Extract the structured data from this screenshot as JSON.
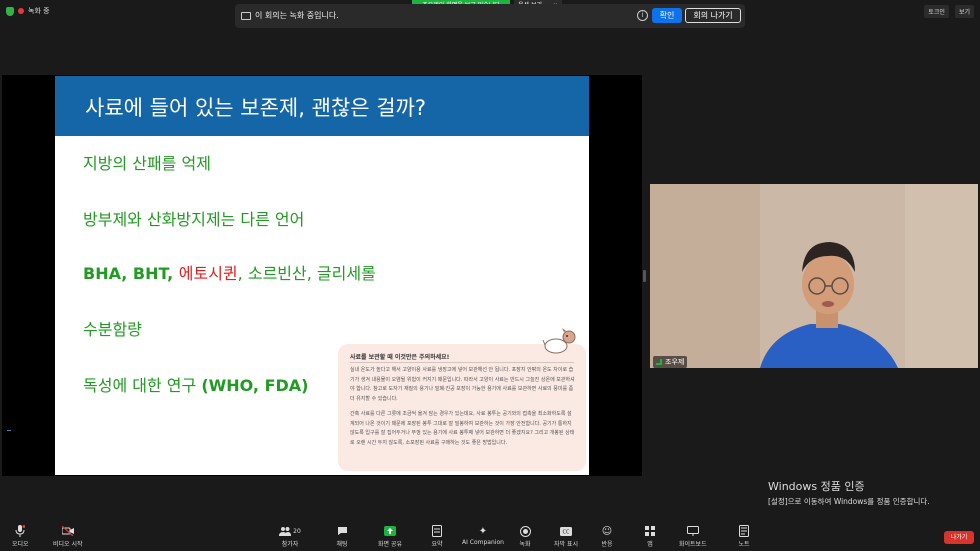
{
  "topbar": {
    "recording_label": "녹화 중",
    "share_status": "조우제의 화면을 보고 있습니다",
    "view_options": "옵션 보기",
    "recording_banner": {
      "message": "이 회의는 녹화 중입니다.",
      "confirm_label": "확인",
      "leave_label": "회의 나가기"
    },
    "right_buttons": [
      "토크인",
      "보기"
    ]
  },
  "slide": {
    "title": "사료에 들어 있는 보존제, 괜찮은 걸까?",
    "bullets": {
      "b1": "지방의 산패를 억제",
      "b2": "방부제와 산화방지제는 다른 언어",
      "b3_part1": "BHA, BHT, ",
      "b3_red": "에토시퀸",
      "b3_norm1": ", 소르빈산, ",
      "b3_norm2": "글리세롤",
      "b4": "수분함량",
      "b5_text": "독성에 대한 연구 ",
      "b5_bold": "(WHO, FDA)"
    },
    "callout": {
      "title": "사료를 보관할 때 이것만은 주의하세요!",
      "p1": "실내 온도가 높다고 해서 고양이용 사료를 냉장고에 넣어 보관해선 안 됩니다. 포장지 안팎의 온도 차이로 습기가 생겨 내용물이 오염될 위험이 커지기 때문입니다. 따라서 고양이 사료는 반드시 그늘진 상온에 보관하셔야 합니다. 참고로 도자기 재질의 용기나 밀폐·진공 포장이 가능한 용기에 사료를 보관하면 사료의 풍미를 좀 더 유지할 수 있습니다.",
      "p2": "간혹 사료를 다른 그릇에 조금씩 옮겨 담는 경우가 있는데요, 사료 봉투는 공기와의 접촉을 최소화하도록 설계되어 나온 것이기 때문에 포장된 봉투 그대로 잘 밀봉하여 보관하는 것이 가장 안전합니다. 공기가 통하지 않도록 입구를 잘 집어두거나 뚜껑 있는 용기에 사료 봉투째 넣어 보관하면 더 좋겠지요? 그리고 개봉된 상태로 오랜 시간 두지 않도록, 소포장된 사료를 구매하는 것도 좋은 방법입니다."
    }
  },
  "video": {
    "participant_name": "조우제"
  },
  "watermark": {
    "line1": "Windows 정품 인증",
    "line2": "[설정]으로 이동하여 Windows를 정품 인증합니다."
  },
  "toolbar": {
    "audio": "오디오",
    "video": "비디오 시작",
    "participants": "참가자",
    "participants_count": "20",
    "chat": "채팅",
    "share": "화면 공유",
    "summary": "요약",
    "ai": "AI Companion",
    "record": "녹화",
    "captions": "자막 표시",
    "reactions": "반응",
    "apps": "앱",
    "whiteboard": "화이트보드",
    "notes": "노트",
    "leave": "나가기"
  },
  "colors": {
    "slide_header": "#1566a6",
    "bullet_green": "#219b21",
    "highlight_red": "#e41e1e",
    "zoom_blue": "#0e72ed",
    "zoom_green": "#1eb33f",
    "leave_red": "#d9342b"
  }
}
